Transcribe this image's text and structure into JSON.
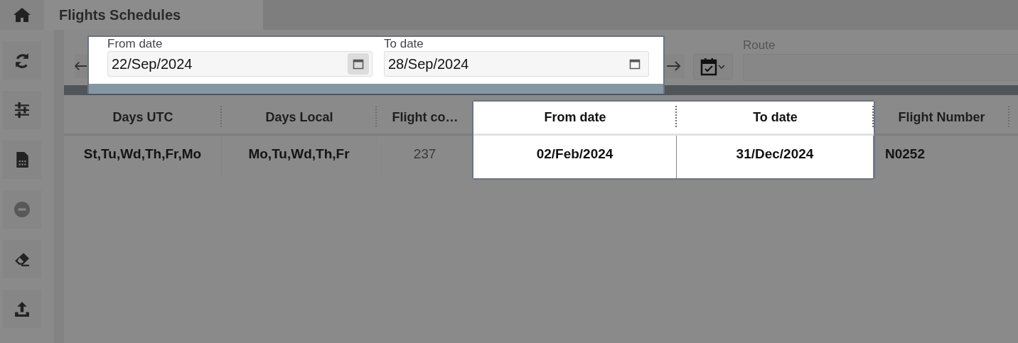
{
  "header": {
    "title": "Flights Schedules"
  },
  "sidebar": {
    "buttons": [
      {
        "kind": "refresh",
        "disabled": false
      },
      {
        "kind": "sliders",
        "disabled": false
      },
      {
        "kind": "sheet",
        "disabled": false
      },
      {
        "kind": "minus",
        "disabled": true
      },
      {
        "kind": "eraser",
        "disabled": false
      },
      {
        "kind": "upload",
        "disabled": false
      }
    ]
  },
  "filters": {
    "highlighted": true,
    "from_date": {
      "label": "From date",
      "value": "22/Sep/2024"
    },
    "to_date": {
      "label": "To date",
      "value": "28/Sep/2024"
    },
    "route": {
      "label": "Route"
    }
  },
  "table": {
    "columns": [
      {
        "title": "Days UTC",
        "highlighted": false,
        "kind": "text"
      },
      {
        "title": "Days Local",
        "highlighted": false,
        "kind": "text"
      },
      {
        "title": "Flight co…",
        "highlighted": false,
        "kind": "number"
      },
      {
        "title": "From date",
        "highlighted": true,
        "kind": "text"
      },
      {
        "title": "To date",
        "highlighted": true,
        "kind": "text"
      },
      {
        "title": "Flight Number",
        "highlighted": false,
        "kind": "code"
      }
    ],
    "rows": [
      {
        "cells": [
          "St,Tu,Wd,Th,Fr,Mo",
          "Mo,Tu,Wd,Th,Fr",
          "237",
          "02/Feb/2024",
          "31/Dec/2024",
          "N0252"
        ]
      }
    ]
  }
}
